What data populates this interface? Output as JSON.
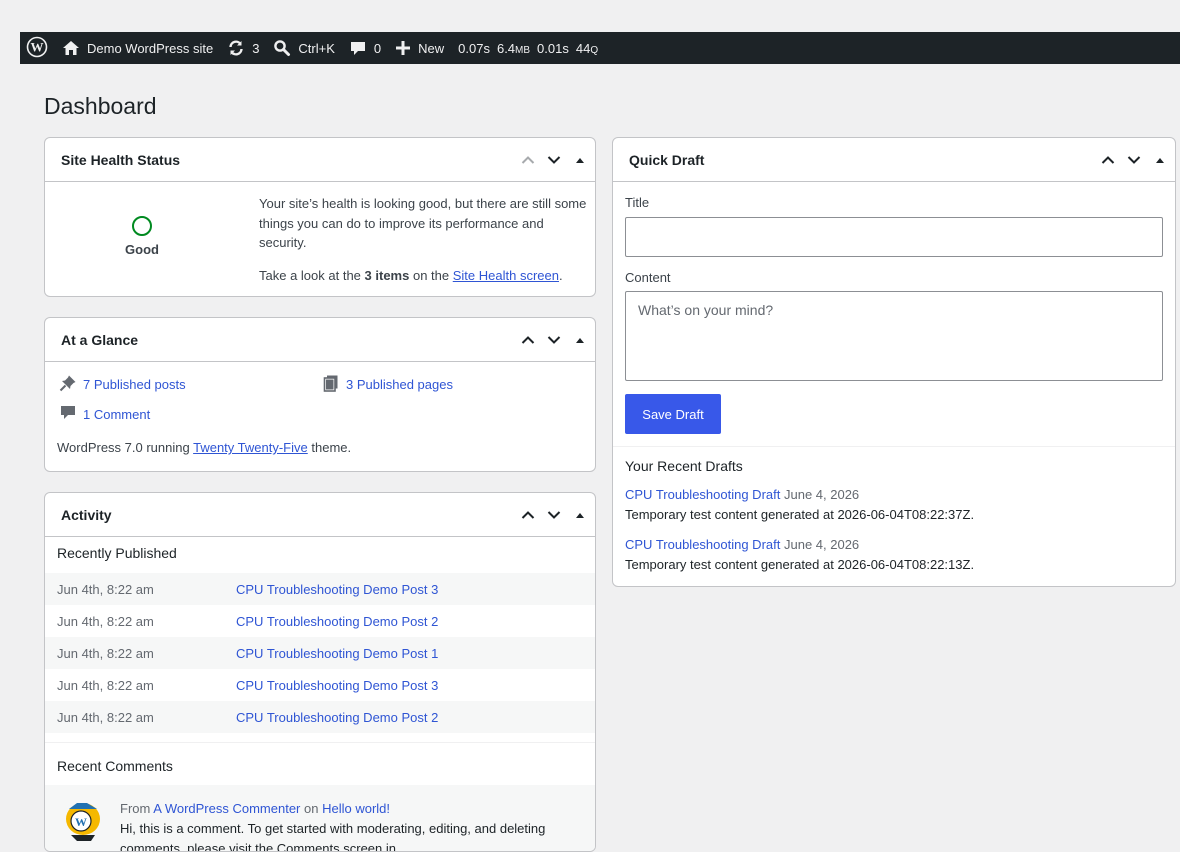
{
  "adminbar": {
    "site_name": "Demo WordPress site",
    "updates_count": "3",
    "search_shortcut": "Ctrl+K",
    "comments_count": "0",
    "new_label": "New",
    "perf_time": "0.07s",
    "perf_mem": "6.4",
    "perf_mem_unit": "MB",
    "perf_query_time": "0.01s",
    "perf_queries": "44",
    "perf_queries_unit": "Q"
  },
  "page": {
    "title": "Dashboard"
  },
  "site_health": {
    "title": "Site Health Status",
    "status": "Good",
    "status_color": "#008a20",
    "message": "Your site’s health is looking good, but there are still some things you can do to improve its performance and security.",
    "look_prefix": "Take a look at the",
    "items_count": "3 items",
    "look_middle": "on the",
    "link": "Site Health screen",
    "look_suffix": "."
  },
  "glance": {
    "title": "At a Glance",
    "posts": "7 Published posts",
    "pages": "3 Published pages",
    "comments": "1 Comment",
    "running_prefix": "WordPress 7.0 running",
    "theme": "Twenty Twenty-Five",
    "running_suffix": "theme."
  },
  "activity": {
    "title": "Activity",
    "recently_published": "Recently Published",
    "rows": [
      {
        "date": "Jun 4th, 8:22 am",
        "title": "CPU Troubleshooting Demo Post 3"
      },
      {
        "date": "Jun 4th, 8:22 am",
        "title": "CPU Troubleshooting Demo Post 2"
      },
      {
        "date": "Jun 4th, 8:22 am",
        "title": "CPU Troubleshooting Demo Post 1"
      },
      {
        "date": "Jun 4th, 8:22 am",
        "title": "CPU Troubleshooting Demo Post 3"
      },
      {
        "date": "Jun 4th, 8:22 am",
        "title": "CPU Troubleshooting Demo Post 2"
      }
    ],
    "recent_comments": "Recent Comments",
    "comment": {
      "from": "From",
      "author": "A WordPress Commenter",
      "on": "on",
      "post": "Hello world!",
      "text_line1": "Hi, this is a comment. To get started with moderating, editing, and deleting",
      "text_line2": "comments, please visit the Comments screen in..."
    }
  },
  "quick_draft": {
    "title": "Quick Draft",
    "title_label": "Title",
    "title_value": "",
    "content_label": "Content",
    "content_placeholder": "What’s on your mind?",
    "save_label": "Save Draft",
    "drafts_heading": "Your Recent Drafts",
    "drafts": [
      {
        "title": "CPU Troubleshooting Draft",
        "date": "June 4, 2026",
        "excerpt": "Temporary test content generated at 2026-06-04T08:22:37Z."
      },
      {
        "title": "CPU Troubleshooting Draft",
        "date": "June 4, 2026",
        "excerpt": "Temporary test content generated at 2026-06-04T08:22:13Z."
      }
    ]
  },
  "colors": {
    "adminbar_bg": "#1d2327",
    "link": "#2f55d4",
    "primary_button": "#3858e9",
    "page_bg": "#f0f0f1"
  },
  "icons": [
    "wordpress-logo-icon",
    "home-icon",
    "updates-icon",
    "search-icon",
    "comment-icon",
    "plus-icon",
    "chevron-up-icon",
    "chevron-down-icon",
    "toggle-arrow-icon",
    "pin-icon",
    "pages-icon",
    "avatar"
  ]
}
